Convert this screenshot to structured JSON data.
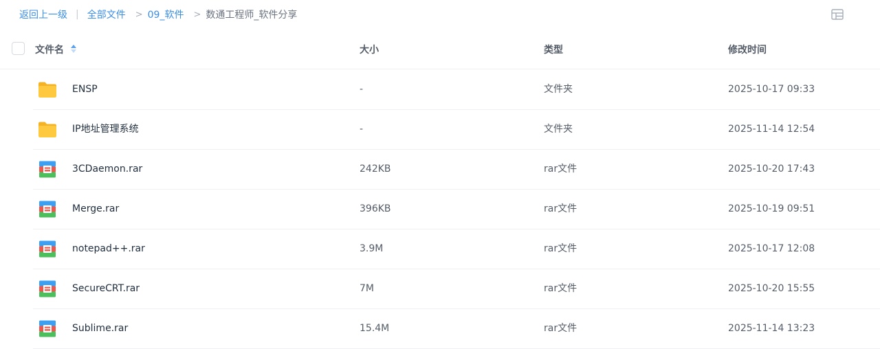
{
  "breadcrumb": {
    "back": "返回上一级",
    "separator": "|",
    "root": "全部文件",
    "arrow": ">",
    "folder": "09_软件",
    "current": "数通工程师_软件分享"
  },
  "columns": {
    "name": "文件名",
    "size": "大小",
    "type": "类型",
    "modified": "修改时间"
  },
  "sort": {
    "column": "文件名",
    "icon": "sort-icon"
  },
  "colors": {
    "accent": "#3a8ee6",
    "folder": "#ffc63d",
    "rar_blue": "#3b9ff3",
    "rar_red": "#f0564a",
    "rar_green": "#4cbf5c"
  },
  "files": [
    {
      "icon": "folder-icon",
      "name": "ENSP",
      "size": "-",
      "type": "文件夹",
      "modified": "2025-10-17 09:33"
    },
    {
      "icon": "folder-icon",
      "name": "IP地址管理系统",
      "size": "-",
      "type": "文件夹",
      "modified": "2025-11-14 12:54"
    },
    {
      "icon": "rar-file-icon",
      "name": "3CDaemon.rar",
      "size": "242KB",
      "type": "rar文件",
      "modified": "2025-10-20 17:43"
    },
    {
      "icon": "rar-file-icon",
      "name": "Merge.rar",
      "size": "396KB",
      "type": "rar文件",
      "modified": "2025-10-19 09:51"
    },
    {
      "icon": "rar-file-icon",
      "name": "notepad++.rar",
      "size": "3.9M",
      "type": "rar文件",
      "modified": "2025-10-17 12:08"
    },
    {
      "icon": "rar-file-icon",
      "name": "SecureCRT.rar",
      "size": "7M",
      "type": "rar文件",
      "modified": "2025-10-20 15:55"
    },
    {
      "icon": "rar-file-icon",
      "name": "Sublime.rar",
      "size": "15.4M",
      "type": "rar文件",
      "modified": "2025-11-14 13:23"
    }
  ]
}
